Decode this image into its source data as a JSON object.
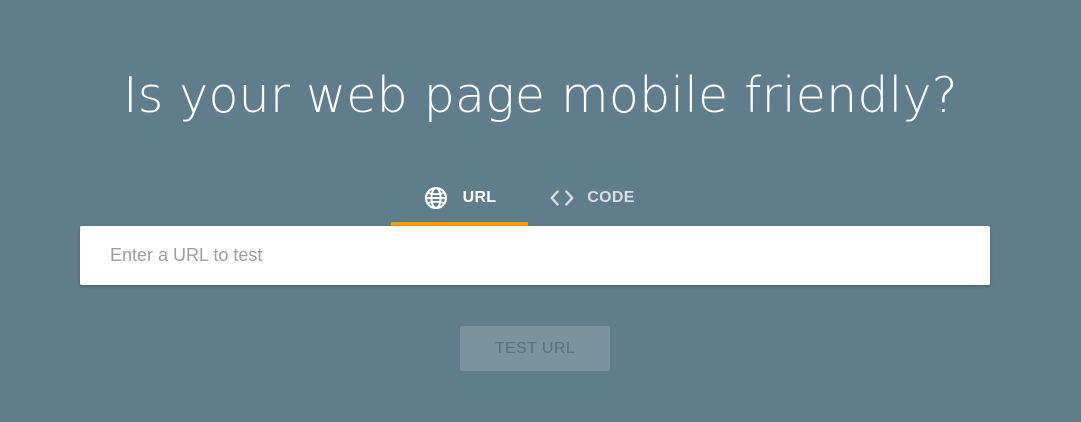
{
  "hero": {
    "title": "Is your web page mobile friendly?"
  },
  "tabs": [
    {
      "label": "URL",
      "icon": "globe-icon",
      "selected": true
    },
    {
      "label": "CODE",
      "icon": "code-icon",
      "selected": false
    }
  ],
  "search": {
    "placeholder": "Enter a URL to test",
    "value": ""
  },
  "action": {
    "label": "TEST URL",
    "enabled": false
  },
  "colors": {
    "background": "#607d8b",
    "tab_indicator": "#ff9f00",
    "button_disabled_bg": "#7b939f",
    "button_disabled_text": "#59707c"
  }
}
